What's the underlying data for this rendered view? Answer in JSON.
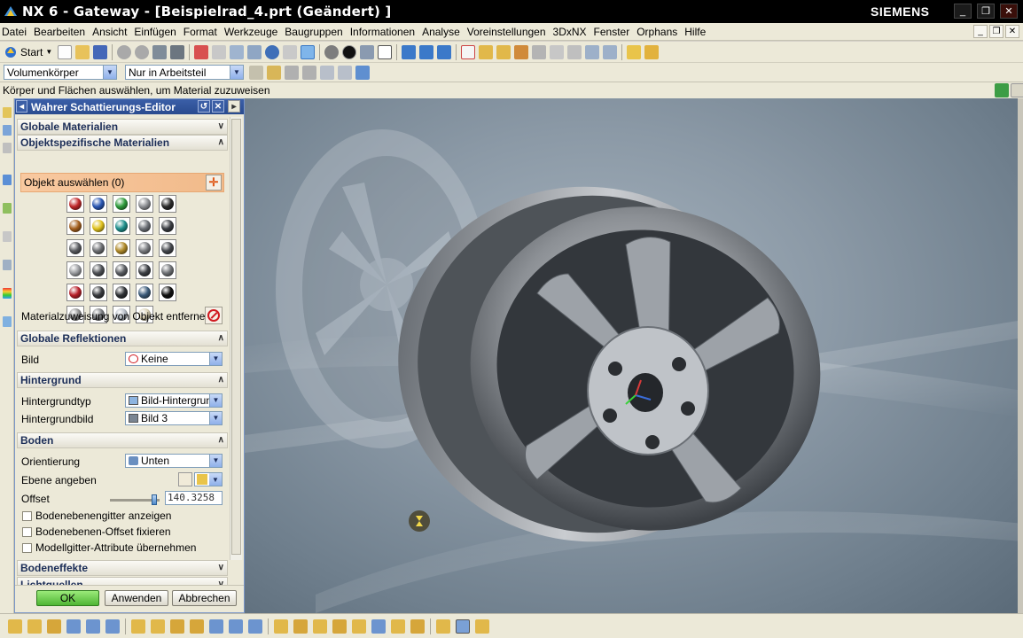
{
  "window": {
    "title": "NX 6 - Gateway - [Beispielrad_4.prt (Geändert) ]",
    "brand": "SIEMENS"
  },
  "menu": [
    "Datei",
    "Bearbeiten",
    "Ansicht",
    "Einfügen",
    "Format",
    "Werkzeuge",
    "Baugruppen",
    "Informationen",
    "Analyse",
    "Voreinstellungen",
    "3DxNX",
    "Fenster",
    "Orphans",
    "Hilfe"
  ],
  "toolbar": {
    "start_label": "Start",
    "type_filter": "Volumenkörper",
    "selection_scope": "Nur in Arbeitsteil"
  },
  "cue_line": "Körper und Flächen auswählen, um Material zuzuweisen",
  "dialog": {
    "title": "Wahrer Schattierungs-Editor",
    "sections": {
      "global_materials": "Globale Materialien",
      "object_materials": "Objektspezifische Materialien",
      "global_reflections": "Globale Reflektionen",
      "background": "Hintergrund",
      "floor": "Boden",
      "floor_effects": "Bodeneffekte",
      "lights": "Lichtquellen"
    },
    "select_object": "Objekt auswählen (0)",
    "remove_material": "Materialzuweisung von Objekt entfernen",
    "reflection": {
      "label": "Bild",
      "value": "Keine"
    },
    "background_type": {
      "label": "Hintergrundtyp",
      "value": "Bild-Hintergrund"
    },
    "background_image": {
      "label": "Hintergrundbild",
      "value": "Bild 3"
    },
    "orientation": {
      "label": "Orientierung",
      "value": "Unten"
    },
    "specify_plane": "Ebene angeben",
    "offset": {
      "label": "Offset",
      "value": "140.3258"
    },
    "checkboxes": [
      "Bodenebenengitter anzeigen",
      "Bodenebenen-Offset fixieren",
      "Modellgitter-Attribute übernehmen"
    ],
    "buttons": {
      "ok": "OK",
      "apply": "Anwenden",
      "cancel": "Abbrechen"
    }
  },
  "materials": [
    [
      "#c0282a",
      "#2a57b3",
      "#2f9b3d",
      "#8e9094",
      "#2b2b2b"
    ],
    [
      "#a4601f",
      "#e0c21e",
      "#1f8f8c",
      "#6c7076",
      "#3a3d42"
    ],
    [
      "#5a5c60",
      "#6d6f73",
      "#b08a2a",
      "#7a7c80",
      "#45484d"
    ],
    [
      "#9a9ca0",
      "#4e5156",
      "#5a5d62",
      "#3d4045",
      "#6f7276"
    ],
    [
      "#b8202a",
      "#3a3c40",
      "#2f3236",
      "#3c5b7a",
      "#101010"
    ],
    [
      "#8e8e8e",
      "#7a7c80",
      "#b5bcc6",
      "#d9cfb2"
    ]
  ],
  "colors": {
    "title_bar": "#000000",
    "dialog_header": "#2a4b8f",
    "selection_highlight": "#f1ba8a",
    "ok_button": "#4fb534"
  }
}
